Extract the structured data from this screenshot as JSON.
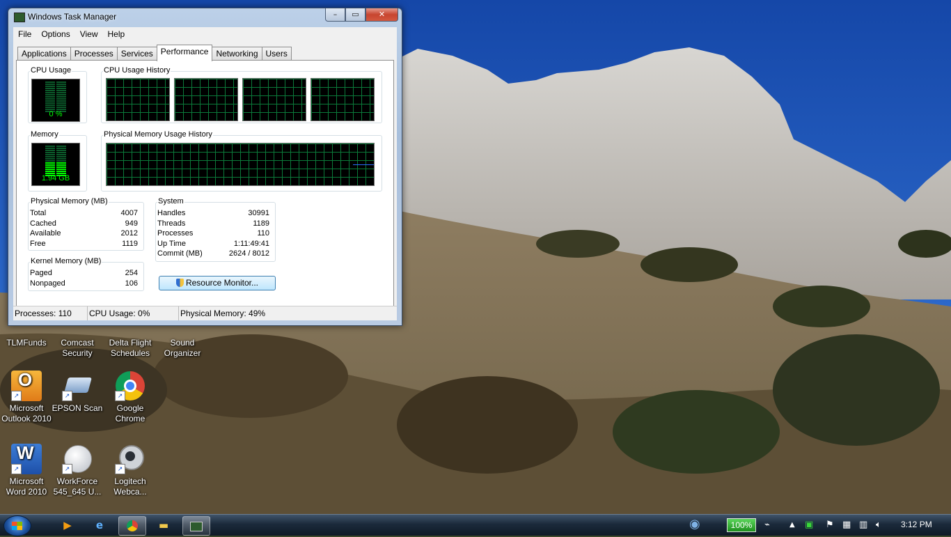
{
  "window": {
    "title": "Windows Task Manager",
    "controls": {
      "minimize": "–",
      "maximize": "▭",
      "close": "✕"
    }
  },
  "menu": [
    "File",
    "Options",
    "View",
    "Help"
  ],
  "tabs": [
    "Applications",
    "Processes",
    "Services",
    "Performance",
    "Networking",
    "Users"
  ],
  "active_tab": "Performance",
  "performance": {
    "cpu_usage_label": "CPU Usage",
    "cpu_usage_value": "0 %",
    "cpu_usage_percent": 0,
    "cpu_history_label": "CPU Usage History",
    "memory_label": "Memory",
    "memory_value": "1.94 GB",
    "memory_fill_fraction": 0.49,
    "memory_history_label": "Physical Memory Usage History",
    "physical_memory": {
      "label": "Physical Memory (MB)",
      "rows": [
        {
          "k": "Total",
          "v": "4007"
        },
        {
          "k": "Cached",
          "v": "949"
        },
        {
          "k": "Available",
          "v": "2012"
        },
        {
          "k": "Free",
          "v": "1119"
        }
      ]
    },
    "system": {
      "label": "System",
      "rows": [
        {
          "k": "Handles",
          "v": "30991"
        },
        {
          "k": "Threads",
          "v": "1189"
        },
        {
          "k": "Processes",
          "v": "110"
        },
        {
          "k": "Up Time",
          "v": "1:11:49:41"
        },
        {
          "k": "Commit (MB)",
          "v": "2624 / 8012"
        }
      ]
    },
    "kernel_memory": {
      "label": "Kernel Memory (MB)",
      "rows": [
        {
          "k": "Paged",
          "v": "254"
        },
        {
          "k": "Nonpaged",
          "v": "106"
        }
      ]
    },
    "resource_monitor_button": "Resource Monitor..."
  },
  "statusbar": {
    "processes": "Processes: 110",
    "cpu": "CPU Usage: 0%",
    "memory": "Physical Memory: 49%"
  },
  "desktop_icons": [
    {
      "label": "TLMFunds",
      "icon": "folder-icon"
    },
    {
      "label": "Comcast\nSecurity",
      "icon": "shield-icon"
    },
    {
      "label": "Delta Flight\nSchedules",
      "icon": "plane-icon"
    },
    {
      "label": "Sound\nOrganizer",
      "icon": "music-icon"
    },
    {
      "label": "Microsoft\nOutlook 2010",
      "icon": "outlook-icon"
    },
    {
      "label": "EPSON Scan",
      "icon": "scanner-icon"
    },
    {
      "label": "Google\nChrome",
      "icon": "chrome-icon"
    },
    {
      "label": "Microsoft\nWord 2010",
      "icon": "word-icon"
    },
    {
      "label": "WorkForce\n545_645 U...",
      "icon": "printer-guide-icon"
    },
    {
      "label": "Logitech\nWebca...",
      "icon": "webcam-icon"
    }
  ],
  "taskbar": {
    "pinned": [
      "media-player-icon",
      "internet-explorer-icon",
      "chrome-icon",
      "explorer-folder-icon",
      "task-manager-icon"
    ],
    "battery": "100%",
    "clock": "3:12 PM"
  },
  "colors": {
    "graph_green": "#00ff00",
    "grid_green": "#0b7a3a",
    "memory_line": "#2a6cff",
    "battery_green": "#1d8f1d"
  }
}
